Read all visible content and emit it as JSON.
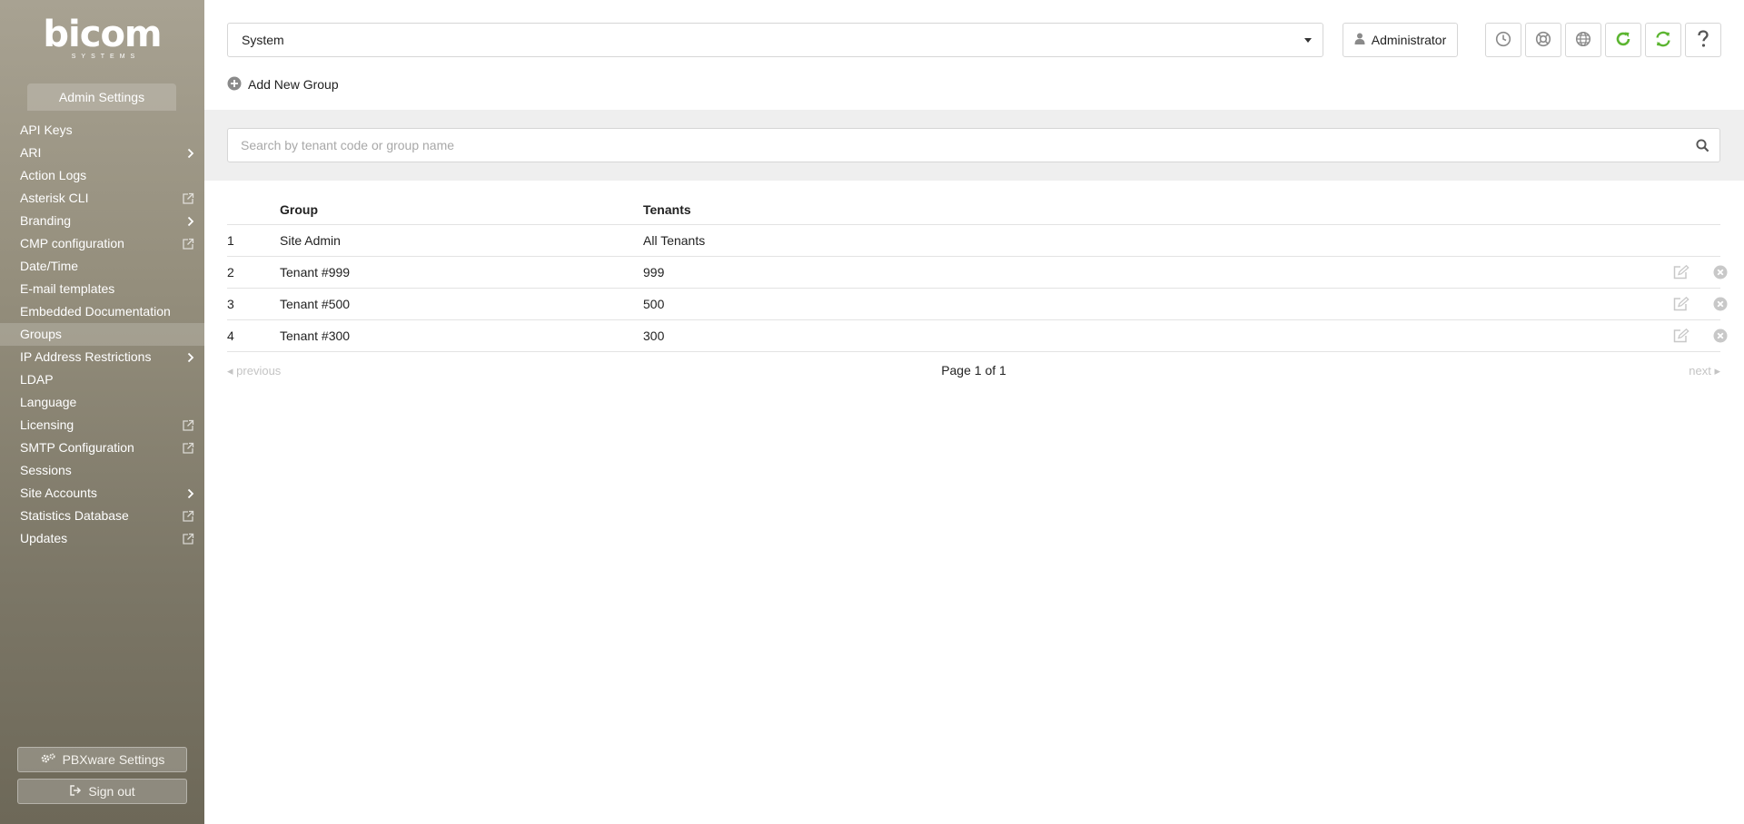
{
  "brand": {
    "logo_word": "bicom",
    "logo_sub": "SYSTEMS"
  },
  "sidebar": {
    "section_title": "Admin Settings",
    "items": [
      {
        "label": "API Keys",
        "suffix": ""
      },
      {
        "label": "ARI",
        "suffix": "chevron"
      },
      {
        "label": "Action Logs",
        "suffix": ""
      },
      {
        "label": "Asterisk CLI",
        "suffix": "external"
      },
      {
        "label": "Branding",
        "suffix": "chevron"
      },
      {
        "label": "CMP configuration",
        "suffix": "external"
      },
      {
        "label": "Date/Time",
        "suffix": ""
      },
      {
        "label": "E-mail templates",
        "suffix": ""
      },
      {
        "label": "Embedded Documentation",
        "suffix": ""
      },
      {
        "label": "Groups",
        "suffix": "",
        "active": true
      },
      {
        "label": "IP Address Restrictions",
        "suffix": "chevron"
      },
      {
        "label": "LDAP",
        "suffix": ""
      },
      {
        "label": "Language",
        "suffix": ""
      },
      {
        "label": "Licensing",
        "suffix": "external"
      },
      {
        "label": "SMTP Configuration",
        "suffix": "external"
      },
      {
        "label": "Sessions",
        "suffix": ""
      },
      {
        "label": "Site Accounts",
        "suffix": "chevron"
      },
      {
        "label": "Statistics Database",
        "suffix": "external"
      },
      {
        "label": "Updates",
        "suffix": "external"
      }
    ],
    "pbxware_button": "PBXware Settings",
    "signout_button": "Sign out"
  },
  "header": {
    "system_select_value": "System",
    "admin_button": "Administrator",
    "icon_buttons": [
      {
        "name": "clock-icon",
        "color": "#8a8a8a"
      },
      {
        "name": "support-lifebuoy-icon",
        "color": "#8a8a8a"
      },
      {
        "name": "globe-icon",
        "color": "#8a8a8a"
      },
      {
        "name": "reload-icon",
        "color": "#5cb531"
      },
      {
        "name": "sync-icon",
        "color": "#5cb531"
      },
      {
        "name": "help-question-icon",
        "color": "#555555"
      }
    ]
  },
  "actions": {
    "add_group": "Add New Group"
  },
  "search": {
    "placeholder": "Search by tenant code or group name",
    "value": ""
  },
  "table": {
    "columns": [
      "Group",
      "Tenants"
    ],
    "rows": [
      {
        "num": "1",
        "group": "Site Admin",
        "tenants": "All Tenants",
        "editable": false
      },
      {
        "num": "2",
        "group": "Tenant #999",
        "tenants": "999",
        "editable": true
      },
      {
        "num": "3",
        "group": "Tenant #500",
        "tenants": "500",
        "editable": true
      },
      {
        "num": "4",
        "group": "Tenant #300",
        "tenants": "300",
        "editable": true
      }
    ]
  },
  "pagination": {
    "previous": "previous",
    "info": "Page 1 of 1",
    "next": "next"
  },
  "colors": {
    "sidebar_top": "#a8a292",
    "sidebar_bottom": "#6d6858",
    "accent_green": "#5cb531",
    "action_icon_grey": "#c8c8c8"
  }
}
